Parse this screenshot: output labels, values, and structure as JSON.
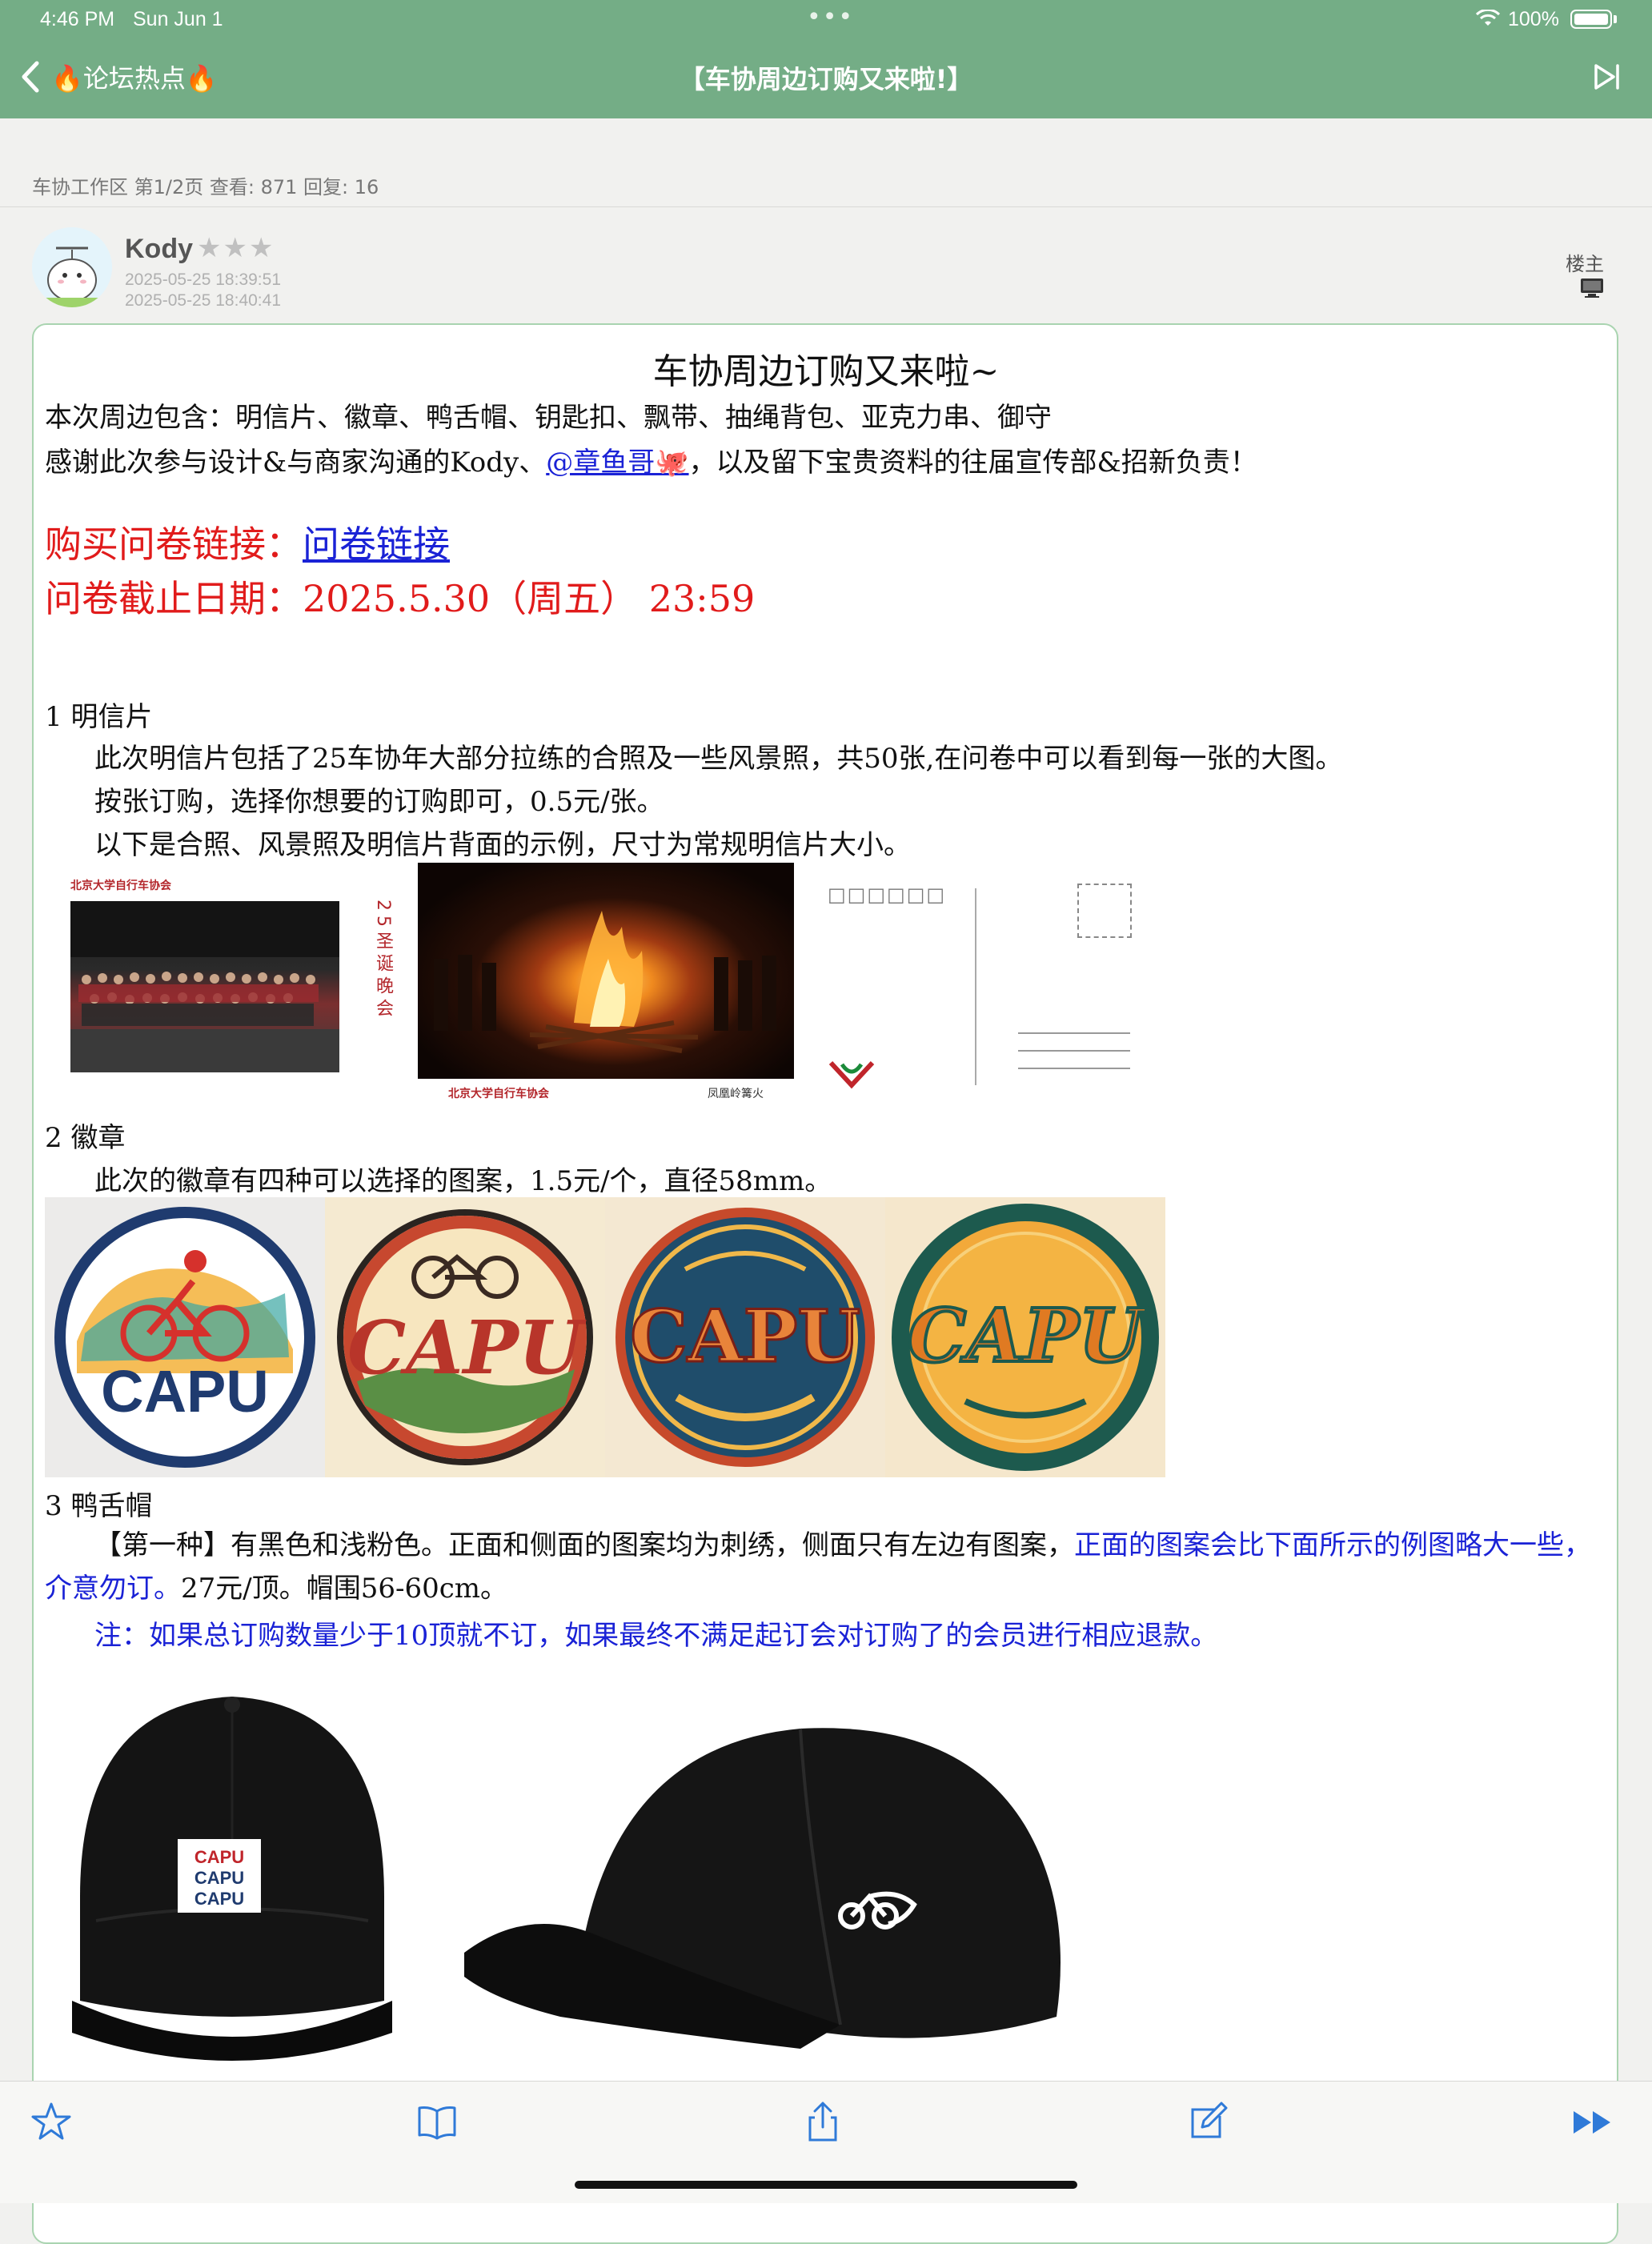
{
  "status_bar": {
    "time": "4:46 PM",
    "date": "Sun Jun 1",
    "battery": "100%"
  },
  "nav": {
    "back_label": "🔥论坛热点🔥",
    "title": "【车协周边订购又来啦!】"
  },
  "breadcrumb": "车协工作区 第1/2页 查看: 871 回复: 16",
  "author": {
    "name": "Kody",
    "stars": "★★★",
    "time_posted": "2025-05-25 18:39:51",
    "time_edited": "2025-05-25 18:40:41",
    "floor": "楼主"
  },
  "post": {
    "heading": "车协周边订购又来啦~",
    "intro_1": "本次周边包含：明信片、徽章、鸭舌帽、钥匙扣、飘带、抽绳背包、亚克力串、御守",
    "intro_2_a": "感谢此次参与设计&与商家沟通的Kody、",
    "intro_2_mention": "@章鱼哥🐙",
    "intro_2_b": "，以及留下宝贵资料的往届宣传部&招新负责！",
    "buy_prefix": "购买问卷链接：",
    "buy_link": "问卷链接",
    "deadline": "问卷截止日期：2025.5.30（周五） 23:59",
    "sections": [
      {
        "title": "1 明信片",
        "p1": "此次明信片包括了25车协年大部分拉练的合照及一些风景照，共50张,在问卷中可以看到每一张的大图。",
        "p2": "按张订购，选择你想要的订购即可，0.5元/张。",
        "p3": "以下是合照、风景照及明信片背面的示例，尺寸为常规明信片大小。"
      },
      {
        "title": "2 徽章",
        "p1": "此次的徽章有四种可以选择的图案，1.5元/个，直径58mm。"
      },
      {
        "title": "3 鸭舌帽",
        "p1_a": "【第一种】有黑色和浅粉色。正面和侧面的图案均为刺绣，侧面只有左边有图案，",
        "p1_b": "正面的图案会比下面所示的例图略大一些，介意勿订。",
        "p1_c": "27元/顶。帽围56-60cm。",
        "note": "注：如果总订购数量少于10顶就不订，如果最终不满足起订会对订购了的会员进行相应退款。"
      }
    ],
    "postcard_1_vertical": "25圣诞晚会",
    "postcard_1_logo": "北京大学自行车协会",
    "postcard_2_caption": "凤凰岭篝火",
    "postcard_3_boxes": "□□□□□□",
    "badge_text": "CAPU",
    "cap_patch": [
      "CAPU",
      "CAPU",
      "CAPU"
    ]
  },
  "colors": {
    "nav_bg": "#74ad86",
    "card_border": "#a9d4b0",
    "red": "#e11b1b",
    "blue": "#1a22d6",
    "toolbar_icon": "#2f7ad8"
  },
  "toolbar_icons": [
    "star-icon",
    "book-icon",
    "share-icon",
    "edit-icon",
    "fast-forward-icon"
  ]
}
